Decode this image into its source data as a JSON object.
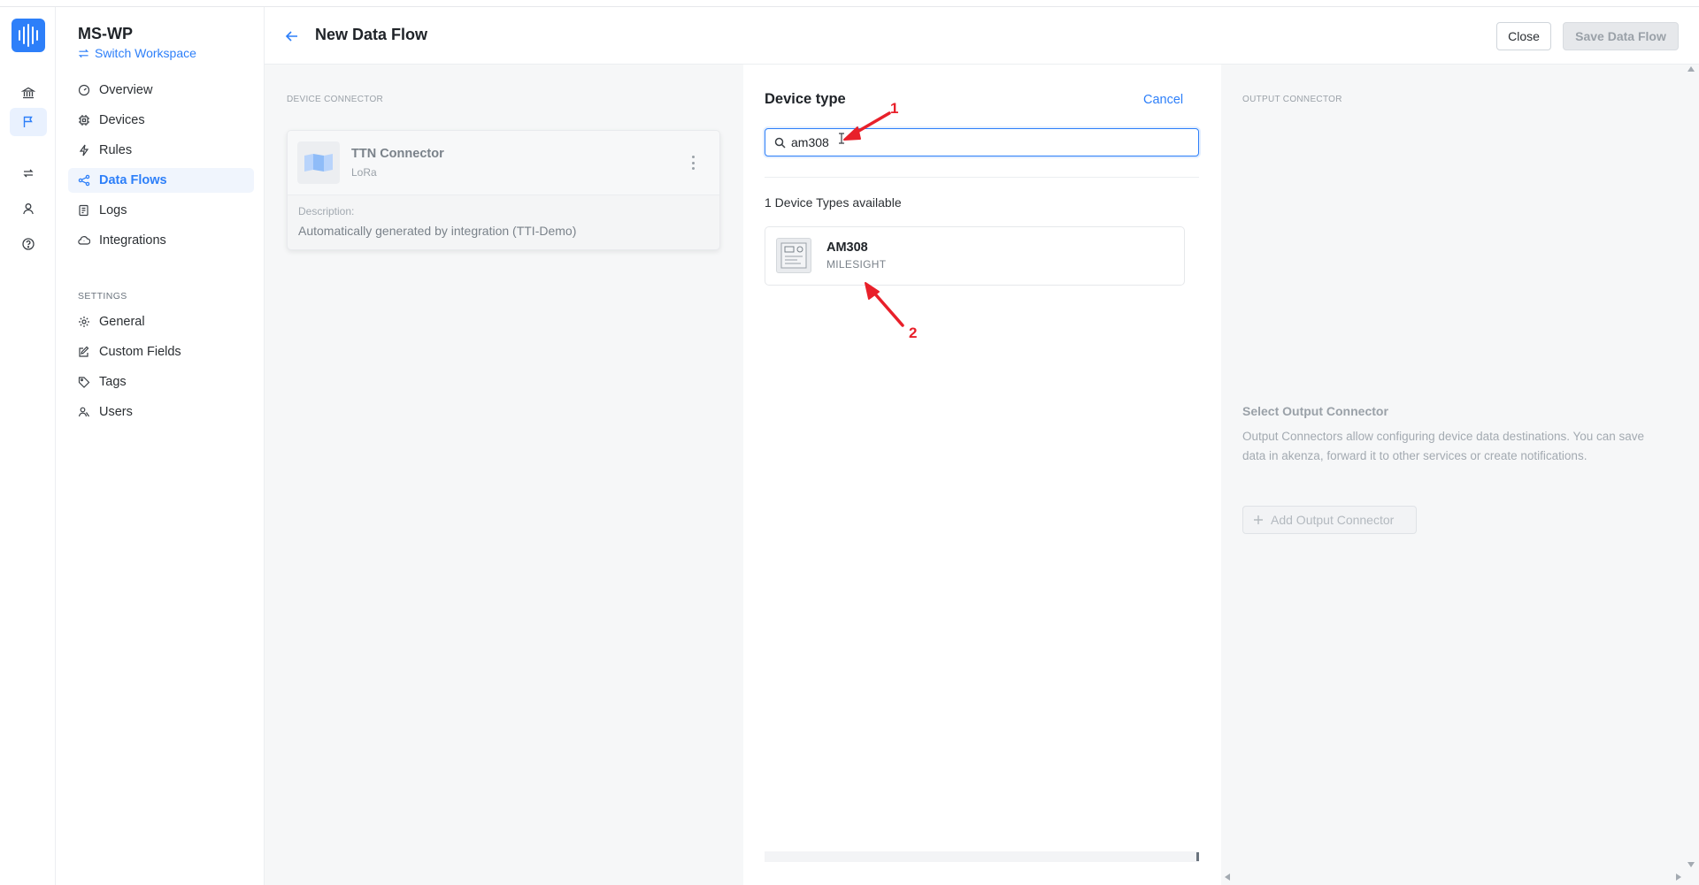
{
  "workspace": {
    "name": "MS-WP",
    "switch_label": "Switch Workspace"
  },
  "rail": {
    "icons": [
      "bank-icon",
      "flag-icon",
      "repeat-icon",
      "user-icon",
      "help-icon"
    ],
    "active": "flag-icon"
  },
  "sidebar": {
    "items": [
      {
        "label": "Overview",
        "icon": "gauge-icon"
      },
      {
        "label": "Devices",
        "icon": "chip-icon"
      },
      {
        "label": "Rules",
        "icon": "bolt-icon"
      },
      {
        "label": "Data Flows",
        "icon": "share-icon",
        "active": true
      },
      {
        "label": "Logs",
        "icon": "log-icon"
      },
      {
        "label": "Integrations",
        "icon": "cloud-icon"
      }
    ],
    "settings_label": "SETTINGS",
    "settings_items": [
      {
        "label": "General",
        "icon": "gear-icon"
      },
      {
        "label": "Custom Fields",
        "icon": "edit-icon"
      },
      {
        "label": "Tags",
        "icon": "tag-icon"
      },
      {
        "label": "Users",
        "icon": "users-icon"
      }
    ]
  },
  "header": {
    "title": "New Data Flow",
    "close_label": "Close",
    "save_label": "Save Data Flow"
  },
  "device_connector": {
    "section_label": "DEVICE CONNECTOR",
    "name": "TTN Connector",
    "subtitle": "LoRa",
    "description_label": "Description:",
    "description": "Automatically generated by integration (TTI-Demo)"
  },
  "device_type": {
    "title": "Device type",
    "cancel_label": "Cancel",
    "search_value": "am308",
    "count_text": "1 Device Types available",
    "results": [
      {
        "name": "AM308",
        "vendor": "MILESIGHT"
      }
    ]
  },
  "output_connector": {
    "section_label": "OUTPUT CONNECTOR",
    "title": "Select Output Connector",
    "description": "Output Connectors allow configuring device data destinations. You can save data in akenza, forward it to other services or create notifications.",
    "add_label": "Add Output Connector"
  },
  "annotations": [
    "1",
    "2"
  ],
  "colors": {
    "accent": "#2d7ff9",
    "annotation": "#e8202a"
  }
}
